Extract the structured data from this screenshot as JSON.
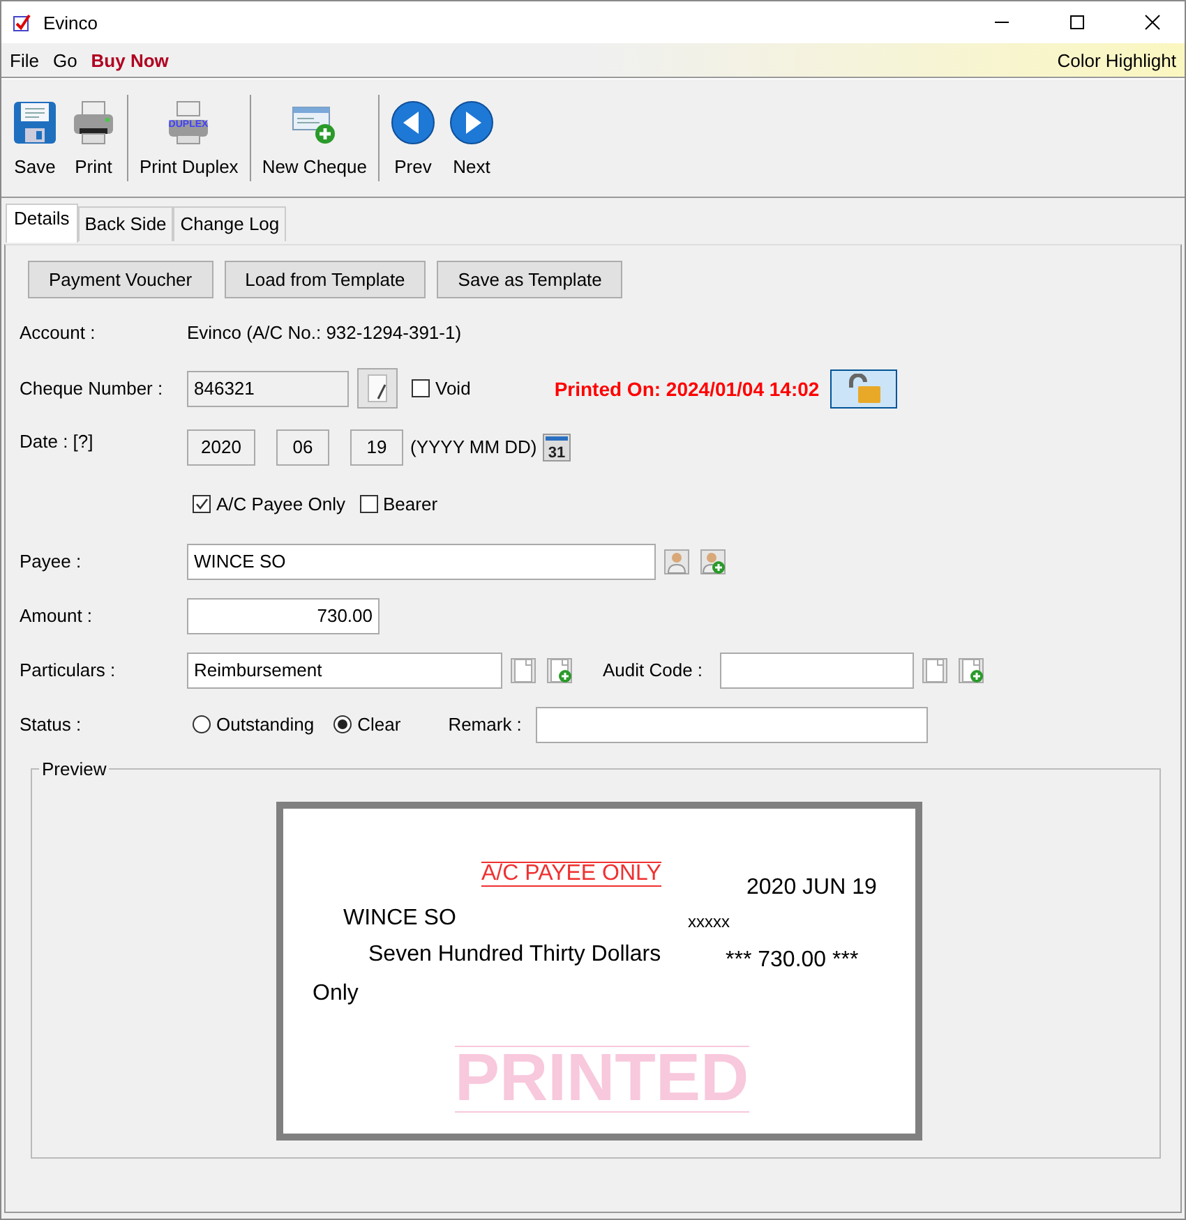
{
  "window": {
    "title": "Evinco"
  },
  "menu": [
    {
      "label": "File",
      "kind": "plain"
    },
    {
      "label": "Go",
      "kind": "plain"
    },
    {
      "label": "Buy Now",
      "kind": "promo"
    }
  ],
  "menu_right": "Color Highlight",
  "toolbar": [
    [
      {
        "label": "Save",
        "kind": "save"
      },
      {
        "label": "Print",
        "kind": "print"
      }
    ],
    [
      {
        "label": "Print Duplex",
        "kind": "duplex",
        "icon_text": "DUPLEX"
      }
    ],
    [
      {
        "label": "New Cheque",
        "kind": "new"
      }
    ],
    [
      {
        "label": "Prev",
        "kind": "prev"
      },
      {
        "label": "Next",
        "kind": "next"
      }
    ]
  ],
  "tabs": [
    {
      "label": "Details",
      "selected": true
    },
    {
      "label": "Back Side",
      "selected": false
    },
    {
      "label": "Change Log",
      "selected": false
    }
  ],
  "action_buttons": [
    "Payment Voucher",
    "Load from Template",
    "Save as Template"
  ],
  "account": {
    "label": "Account :",
    "value": "Evinco (A/C No.: 932-1294-391-1)"
  },
  "cheque_number": {
    "label": "Cheque Number :",
    "value": "846321",
    "void": {
      "label": "Void",
      "checked": false
    },
    "printed_on": "Printed On: 2024/01/04 14:02"
  },
  "date": {
    "label": "Date : [?]",
    "year": "2020",
    "month": "06",
    "day": "19",
    "format": "(YYYY MM DD)",
    "calendar_text": "31"
  },
  "options": [
    {
      "label": "A/C Payee Only",
      "checked": true
    },
    {
      "label": "Bearer",
      "checked": false
    }
  ],
  "payee": {
    "label": "Payee :",
    "value": "WINCE SO"
  },
  "amount": {
    "label": "Amount :",
    "value": "730.00"
  },
  "particulars": {
    "label": "Particulars :",
    "value": "Reimbursement"
  },
  "audit_code": {
    "label": "Audit Code :"
  },
  "status": {
    "label": "Status :",
    "options": [
      {
        "label": "Outstanding",
        "selected": false
      },
      {
        "label": "Clear",
        "selected": true
      }
    ]
  },
  "remark": {
    "label": "Remark :"
  },
  "preview": {
    "title": "Preview",
    "crossing": "A/C PAYEE ONLY",
    "date": "2020 JUN 19",
    "payee": "WINCE SO",
    "mask": "xxxxx",
    "words": "Seven Hundred Thirty Dollars",
    "amount": "*** 730.00 ***",
    "only": "Only",
    "stamp": "PRINTED"
  }
}
